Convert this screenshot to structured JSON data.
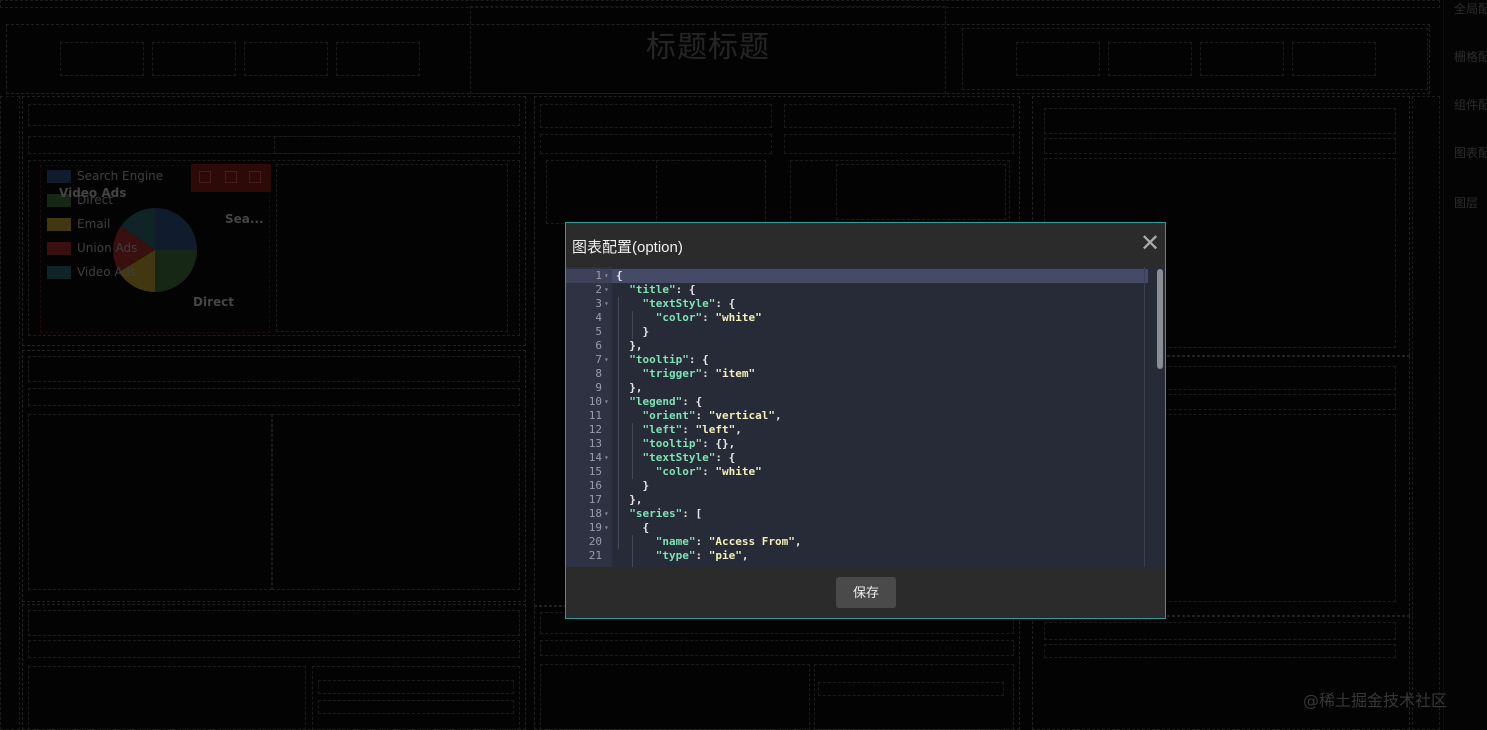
{
  "header": {
    "title": "标题标题"
  },
  "right_nav": {
    "items": [
      "全局配",
      "栅格配",
      "组件配",
      "图表配",
      "图层"
    ]
  },
  "chart_widget": {
    "legend": [
      {
        "label": "Search Engine",
        "color": "#2b4a7a"
      },
      {
        "label": "Direct",
        "color": "#3d6a3a"
      },
      {
        "label": "Email",
        "color": "#b39a2a"
      },
      {
        "label": "Union Ads",
        "color": "#a0262a"
      },
      {
        "label": "Video Ads",
        "color": "#2c5f6a"
      }
    ],
    "pie_labels": [
      "Video Ads",
      "Sea...",
      "Direct"
    ]
  },
  "modal": {
    "title": "图表配置(option)",
    "close_label": "✕",
    "save_label": "保存",
    "code_lines": [
      {
        "n": "1",
        "text": "{"
      },
      {
        "n": "2",
        "text": "  \"title\": {"
      },
      {
        "n": "3",
        "text": "    \"textStyle\": {"
      },
      {
        "n": "4",
        "text": "      \"color\": \"white\""
      },
      {
        "n": "5",
        "text": "    }"
      },
      {
        "n": "6",
        "text": "  },"
      },
      {
        "n": "7",
        "text": "  \"tooltip\": {"
      },
      {
        "n": "8",
        "text": "    \"trigger\": \"item\""
      },
      {
        "n": "9",
        "text": "  },"
      },
      {
        "n": "10",
        "text": "  \"legend\": {"
      },
      {
        "n": "11",
        "text": "    \"orient\": \"vertical\","
      },
      {
        "n": "12",
        "text": "    \"left\": \"left\","
      },
      {
        "n": "13",
        "text": "    \"tooltip\": {},"
      },
      {
        "n": "14",
        "text": "    \"textStyle\": {"
      },
      {
        "n": "15",
        "text": "      \"color\": \"white\""
      },
      {
        "n": "16",
        "text": "    }"
      },
      {
        "n": "17",
        "text": "  },"
      },
      {
        "n": "18",
        "text": "  \"series\": ["
      },
      {
        "n": "19",
        "text": "    {"
      },
      {
        "n": "20",
        "text": "      \"name\": \"Access From\","
      },
      {
        "n": "21",
        "text": "      \"type\": \"pie\","
      }
    ],
    "fold_lines": [
      "1",
      "2",
      "3",
      "7",
      "10",
      "14",
      "18",
      "19"
    ]
  },
  "watermark": "@稀土掘金技术社区"
}
